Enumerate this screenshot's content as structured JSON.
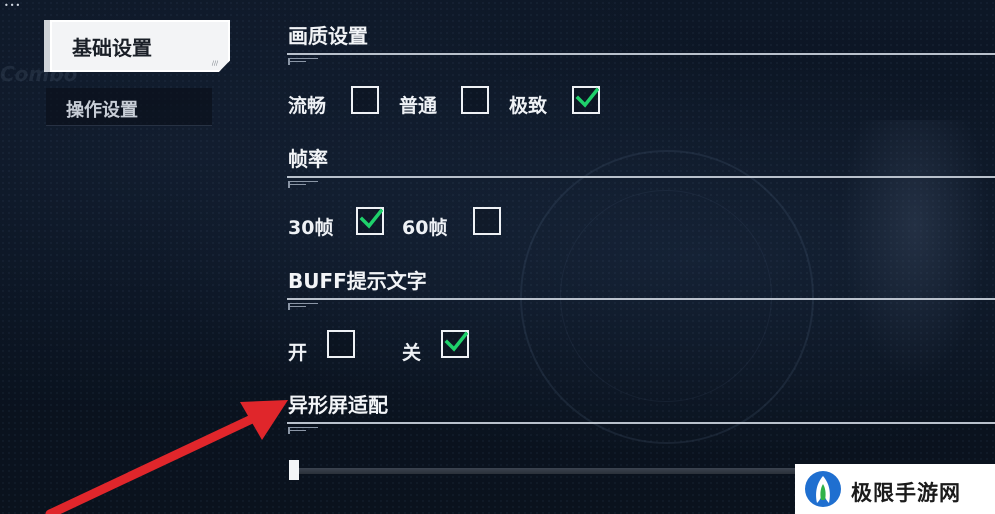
{
  "top_indicator": "•••",
  "background_text": "Combo",
  "sidebar": {
    "active_tab": {
      "label": "基础设置",
      "tag": "///"
    },
    "inactive_tab": {
      "label": "操作设置"
    }
  },
  "sections": {
    "quality": {
      "title": "画质设置",
      "options": [
        {
          "label": "流畅",
          "checked": false
        },
        {
          "label": "普通",
          "checked": false
        },
        {
          "label": "极致",
          "checked": true
        }
      ]
    },
    "framerate": {
      "title": "帧率",
      "options": [
        {
          "label": "30帧",
          "checked": true
        },
        {
          "label": "60帧",
          "checked": false
        }
      ]
    },
    "buff_text": {
      "title": "BUFF提示文字",
      "options": [
        {
          "label": "开",
          "checked": false
        },
        {
          "label": "关",
          "checked": true
        }
      ]
    },
    "notch": {
      "title": "异形屏适配",
      "slider_value": 0
    }
  },
  "watermark": {
    "text": "极限手游网"
  },
  "colors": {
    "check": "#1fd16b",
    "annotation_arrow": "#e0262b",
    "accent_text": "#f2f4f7"
  }
}
